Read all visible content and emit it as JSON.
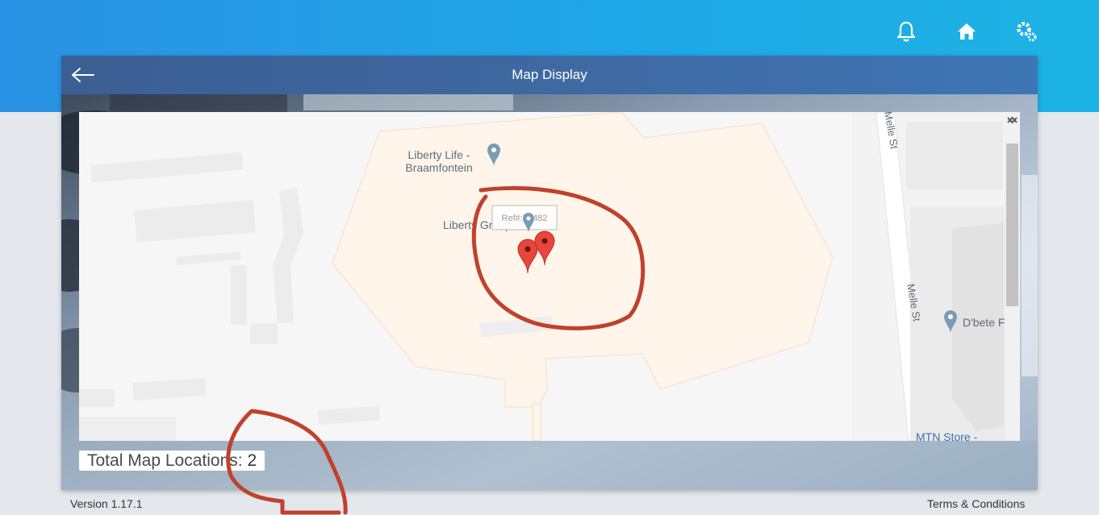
{
  "header": {
    "icons": [
      "bell-icon",
      "home-icon",
      "settings-icon"
    ]
  },
  "card": {
    "title": "Map Display",
    "back_icon": "arrow-left-icon"
  },
  "map": {
    "places": {
      "liberty_life_line1": "Liberty Life -",
      "liberty_life_line2": "Braamfontein",
      "liberty_group": "Liberty Group",
      "ref_label": "Ref#:73482",
      "dbete": "D'bete F",
      "mtn_store": "MTN Store -",
      "melle_st_1": "Melle St",
      "melle_st_2": "Melle St"
    },
    "marker_color": "#e8453c",
    "poi_color": "#7b9cb3"
  },
  "summary": {
    "label": "Total Map Locations:",
    "count": "2"
  },
  "footer": {
    "version": "Version 1.17.1",
    "terms": "Terms & Conditions"
  },
  "colors": {
    "topbar": "#1ea8e6",
    "card_header": "#3e6aa3",
    "annotation": "#c0412d"
  }
}
